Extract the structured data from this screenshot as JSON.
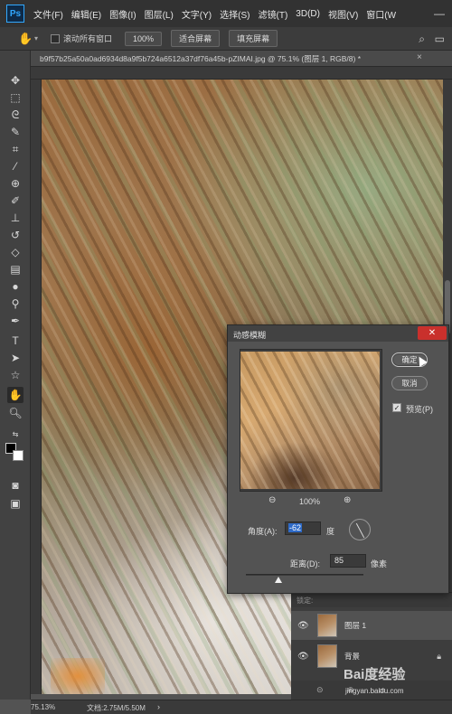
{
  "app": {
    "logo": "Ps",
    "menu": [
      "文件(F)",
      "编辑(E)",
      "图像(I)",
      "图层(L)",
      "文字(Y)",
      "选择(S)",
      "滤镜(T)",
      "3D(D)",
      "视图(V)",
      "窗口(W"
    ],
    "window_controls": "—"
  },
  "options_bar": {
    "scroll_all_label": "滚动所有窗口",
    "zoom_value": "100%",
    "fit_screen_label": "适合屏幕",
    "fill_screen_label": "填充屏幕"
  },
  "document": {
    "tab_title": "b9f57b25a50a0ad6934d8a9f5b724a6512a37df76a45b-pZIMAI.jpg @ 75.1% (图层 1, RGB/8) *",
    "tab_close": "×"
  },
  "dialog": {
    "title": "动感模糊",
    "close_label": "✕",
    "ok_label": "确定",
    "cancel_label": "取消",
    "preview_label": "预览(P)",
    "preview_checked": true,
    "zoom_level": "100%",
    "angle_label": "角度(A):",
    "angle_value": "-62",
    "angle_unit": "度",
    "distance_label": "距离(D):",
    "distance_value": "85",
    "distance_unit": "像素",
    "distance_fraction": 0.28
  },
  "layers_panel": {
    "header_text": "锁定:",
    "layers": [
      {
        "name": "图层 1",
        "selected": true,
        "locked": false
      },
      {
        "name": "背景",
        "selected": false,
        "locked": true
      }
    ]
  },
  "status_bar": {
    "zoom": "75.13%",
    "doc_info": "文档:2.75M/5.50M",
    "arrow": "›"
  },
  "watermark": {
    "logo_text": "Bai度经验",
    "url": "jingyan.baidu.com"
  },
  "tools": [
    "move-icon",
    "marquee-icon",
    "lasso-icon",
    "quick-select-icon",
    "crop-icon",
    "eyedropper-icon",
    "healing-icon",
    "brush-icon",
    "stamp-icon",
    "history-brush-icon",
    "eraser-icon",
    "gradient-icon",
    "blur-icon",
    "dodge-icon",
    "pen-icon",
    "type-icon",
    "path-select-icon",
    "shape-icon",
    "hand-icon",
    "zoom-icon"
  ]
}
